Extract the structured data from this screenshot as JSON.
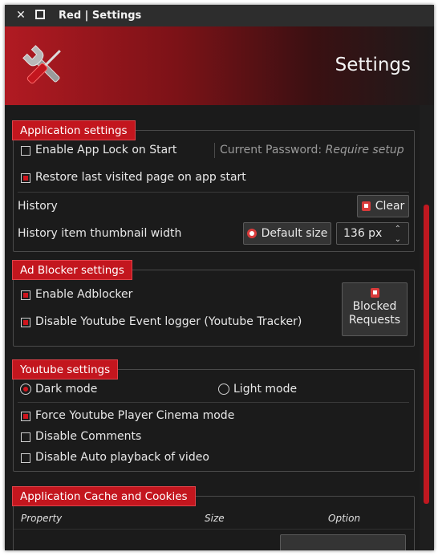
{
  "window": {
    "title": "Red | Settings",
    "close_glyph": "✕"
  },
  "header": {
    "title": "Settings",
    "icon": "tools-icon"
  },
  "app_settings": {
    "label": "Application settings",
    "app_lock_label": "Enable App Lock on Start",
    "app_lock_checked": false,
    "password_label": "Current Password:",
    "password_value": "Require setup",
    "restore_label": "Restore last visited page on app start",
    "restore_checked": true,
    "history_label": "History",
    "clear_label": "Clear",
    "thumb_label": "History item thumbnail width",
    "default_size_label": "Default size",
    "thumb_width_value": "136 px"
  },
  "adblock": {
    "label": "Ad Blocker settings",
    "enable_label": "Enable Adblocker",
    "enable_checked": true,
    "tracker_label": "Disable Youtube Event logger (Youtube Tracker)",
    "tracker_checked": true,
    "blocked_line1": "Blocked",
    "blocked_line2": "Requests"
  },
  "youtube": {
    "label": "Youtube settings",
    "dark_label": "Dark mode",
    "dark_selected": true,
    "light_label": "Light mode",
    "cinema_label": "Force Youtube Player Cinema mode",
    "cinema_checked": true,
    "comments_label": "Disable Comments",
    "comments_checked": false,
    "autoplay_label": "Disable Auto playback of video",
    "autoplay_checked": false
  },
  "cache": {
    "label": "Application Cache and Cookies",
    "columns": [
      "Property",
      "Size",
      "Option"
    ]
  },
  "colors": {
    "accent": "#c3161e",
    "background": "#1b1b1b"
  }
}
